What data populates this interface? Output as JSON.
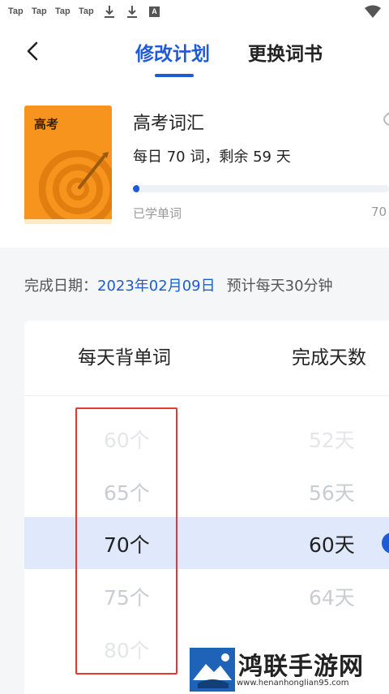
{
  "status_bar": {
    "tap_items": [
      "Tap",
      "Tap",
      "Tap",
      "Tap"
    ],
    "icons": [
      "download-icon",
      "download-icon",
      "font-a-icon",
      "wifi-icon"
    ],
    "a_glyph": "A"
  },
  "header": {
    "tabs": [
      {
        "label": "修改计划",
        "active": true
      },
      {
        "label": "更换词书",
        "active": false
      }
    ]
  },
  "book": {
    "cover_label": "高考",
    "title": "高考词汇",
    "plan": "每日 70 词，剩余 59 天",
    "progress_label": "已学单词",
    "progress_total": "70",
    "progress_fraction": 0.0,
    "cover_color": "#f7941d"
  },
  "schedule": {
    "date_label": "完成日期：",
    "date_value": "2023年02月09日",
    "estimate": "预计每天30分钟"
  },
  "picker": {
    "col_left_header": "每天背单词",
    "col_right_header": "完成天数",
    "rows": [
      {
        "words": "60个",
        "days": "52天"
      },
      {
        "words": "65个",
        "days": "56天"
      },
      {
        "words": "70个",
        "days": "60天"
      },
      {
        "words": "75个",
        "days": "64天"
      },
      {
        "words": "80个",
        "days": ""
      }
    ],
    "selected_index": 2
  },
  "colors": {
    "accent": "#1f5bd6",
    "highlight_box": "#e53935",
    "selected_band": "#dfe9fb"
  },
  "watermark": {
    "title": "鸿联手游网",
    "url": "www.henanhonglian95.com"
  }
}
